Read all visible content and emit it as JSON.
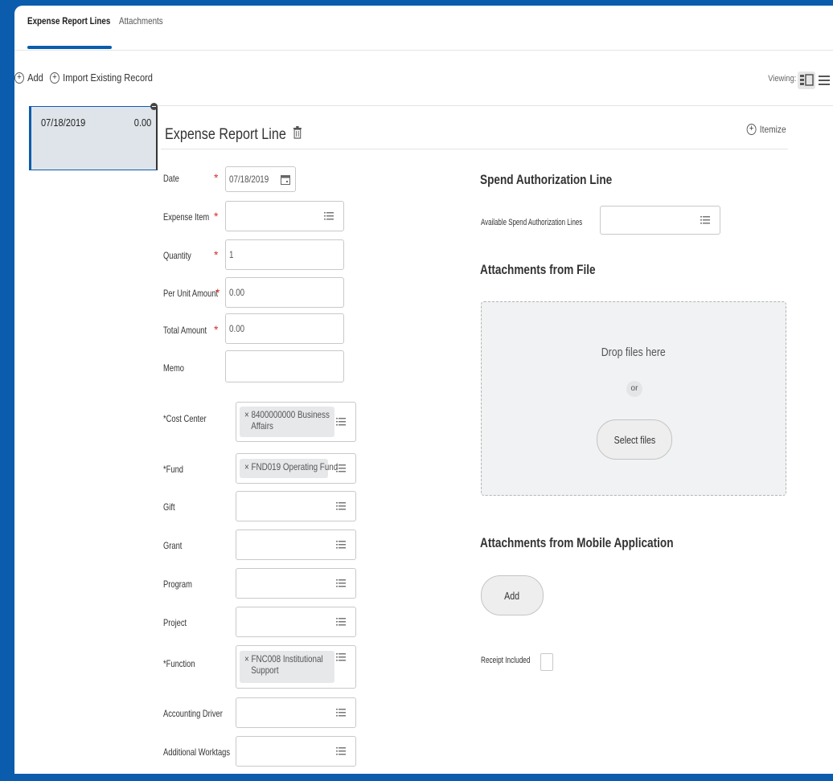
{
  "tabs": [
    {
      "label": "Expense Report Lines",
      "active": true
    },
    {
      "label": "Attachments",
      "active": false
    }
  ],
  "toolbar": {
    "add_label": "Add",
    "import_label": "Import Existing Record",
    "viewing_label": "Viewing:"
  },
  "lines": [
    {
      "date": "07/18/2019",
      "amount": "0.00"
    }
  ],
  "section": {
    "title": "Expense Report Line",
    "itemize_label": "Itemize"
  },
  "form": {
    "date": {
      "label": "Date",
      "value": "07/18/2019",
      "required": true
    },
    "expense_item": {
      "label": "Expense Item",
      "value": "",
      "required": true
    },
    "quantity": {
      "label": "Quantity",
      "value": "1",
      "required": true
    },
    "per_unit_amount": {
      "label": "Per Unit Amount",
      "value": "0.00",
      "required": true
    },
    "total_amount": {
      "label": "Total Amount",
      "value": "0.00",
      "required": true
    },
    "memo": {
      "label": "Memo",
      "value": ""
    },
    "cost_center": {
      "label": "*Cost Center",
      "value_line1": "× 8400000000 Business",
      "value_line2": "Affairs"
    },
    "fund": {
      "label": "*Fund",
      "value": "× FND019 Operating Fund"
    },
    "gift": {
      "label": "Gift",
      "value": ""
    },
    "grant": {
      "label": "Grant",
      "value": ""
    },
    "program": {
      "label": "Program",
      "value": ""
    },
    "project": {
      "label": "Project",
      "value": ""
    },
    "function": {
      "label": "*Function",
      "value_line1": "× FNC008 Institutional",
      "value_line2": "Support"
    },
    "accounting_driver": {
      "label": "Accounting Driver",
      "value": ""
    },
    "additional_worktags": {
      "label": "Additional Worktags",
      "value": ""
    }
  },
  "right": {
    "spend_title": "Spend Authorization Line",
    "spend_label": "Available Spend Authorization Lines",
    "attach_file_title": "Attachments from File",
    "drop_text": "Drop files here",
    "or_text": "or",
    "select_files_label": "Select files",
    "attach_mobile_title": "Attachments from Mobile Application",
    "mobile_add_label": "Add",
    "receipt_label": "Receipt Included",
    "receipt_checked": false
  },
  "colors": {
    "frame_blue": "#0b5cad",
    "required_red": "#d42d2d"
  }
}
